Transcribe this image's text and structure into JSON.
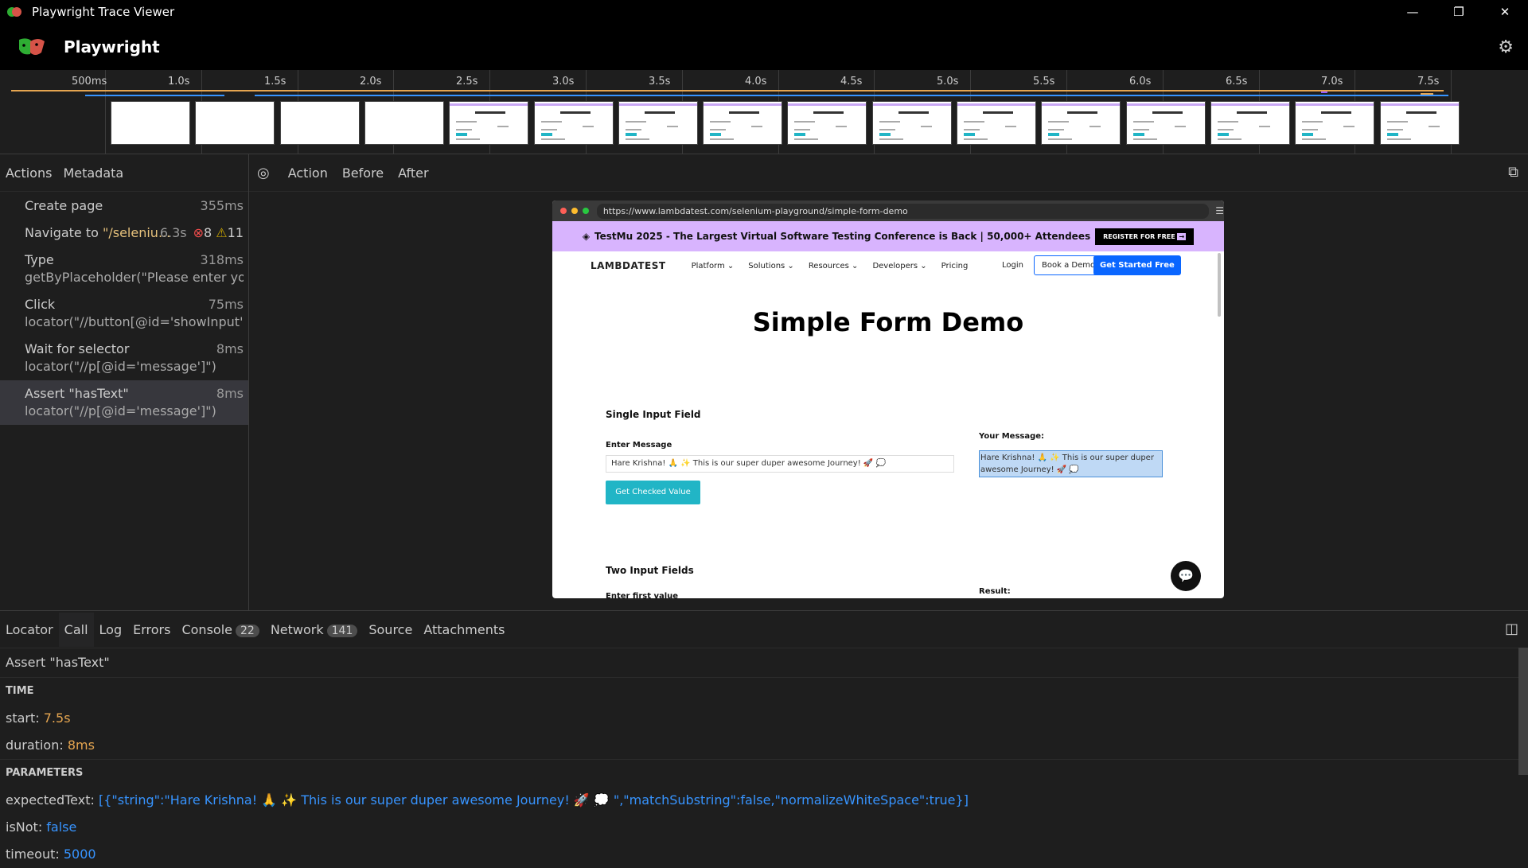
{
  "window": {
    "title": "Playwright Trace Viewer",
    "controls": [
      "—",
      "❐",
      "✕"
    ]
  },
  "header": {
    "brand": "Playwright",
    "gear_icon": "gear-icon"
  },
  "timeline": {
    "ticks": [
      "500ms",
      "1.0s",
      "1.5s",
      "2.0s",
      "2.5s",
      "3.0s",
      "3.5s",
      "4.0s",
      "4.5s",
      "5.0s",
      "5.5s",
      "6.0s",
      "6.5s",
      "7.0s",
      "7.5s"
    ],
    "thumbnails_blank": 4,
    "thumbnails_page": 12
  },
  "left_tabs": [
    "Actions",
    "Metadata"
  ],
  "actions": [
    {
      "title": "Create page",
      "sub": "",
      "time": "355ms"
    },
    {
      "title": "Navigate to ",
      "url": "\"/seleniu...",
      "time": "6.3s",
      "errors": "8",
      "warnings": "11"
    },
    {
      "title": "Type",
      "sub": "getByPlaceholder(\"Please enter your ...",
      "time": "318ms"
    },
    {
      "title": "Click",
      "sub": "locator(\"//button[@id='showInput']\")",
      "time": "75ms"
    },
    {
      "title": "Wait for selector",
      "sub": "locator(\"//p[@id='message']\")",
      "time": "8ms"
    },
    {
      "title": "Assert \"hasText\"",
      "sub": "locator(\"//p[@id='message']\")",
      "time": "8ms"
    }
  ],
  "right_tabs": [
    "Action",
    "Before",
    "After"
  ],
  "snapshot": {
    "url": "https://www.lambdatest.com/selenium-playground/simple-form-demo",
    "banner_text": "TestMu 2025 - The Largest Virtual Software Testing Conference is Back | 50,000+ Attendees",
    "banner_button": "REGISTER FOR FREE",
    "logo": "LAMBDATEST",
    "nav": [
      "Platform ⌄",
      "Solutions ⌄",
      "Resources ⌄",
      "Developers ⌄",
      "Pricing"
    ],
    "login": "Login",
    "book_demo": "Book a Demo",
    "get_started": "Get Started Free",
    "heading": "Simple Form Demo",
    "single_input_title": "Single Input Field",
    "enter_message": "Enter Message",
    "input_value": "Hare Krishna! 🙏 ✨ This is our super duper awesome Journey! 🚀 💭",
    "check_button": "Get Checked Value",
    "your_message_label": "Your Message:",
    "your_message_value": "Hare Krishna! 🙏 ✨ This is our super duper awesome Journey! 🚀 💭",
    "two_input_title": "Two Input Fields",
    "enter_first_value": "Enter first value",
    "result_label": "Result:"
  },
  "bottom_tabs": [
    {
      "label": "Locator"
    },
    {
      "label": "Call"
    },
    {
      "label": "Log"
    },
    {
      "label": "Errors"
    },
    {
      "label": "Console",
      "count": "22"
    },
    {
      "label": "Network",
      "count": "141"
    },
    {
      "label": "Source"
    },
    {
      "label": "Attachments"
    }
  ],
  "details": {
    "title": "Assert \"hasText\"",
    "time_section": "TIME",
    "start_key": "start:",
    "start_val": "7.5s",
    "duration_key": "duration:",
    "duration_val": "8ms",
    "params_section": "PARAMETERS",
    "expected_key": "expectedText:",
    "expected_val": "[{\"string\":\"Hare Krishna! 🙏 ✨ This is our super duper awesome Journey! 🚀 💭 \",\"matchSubstring\":false,\"normalizeWhiteSpace\":true}]",
    "isnot_key": "isNot:",
    "isnot_val": "false",
    "timeout_key": "timeout:",
    "timeout_val": "5000"
  }
}
